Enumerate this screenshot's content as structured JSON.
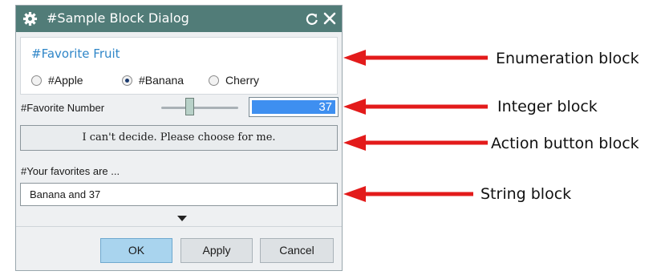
{
  "dialog": {
    "title": "#Sample Block Dialog",
    "title_bar_color": "#517c78",
    "enumeration": {
      "title": "#Favorite Fruit",
      "options": [
        "#Apple",
        "#Banana",
        "Cherry"
      ],
      "selected": "#Banana"
    },
    "integer": {
      "label": "#Favorite Number",
      "value": "37"
    },
    "action_button_label": "I can't decide. Please choose for me.",
    "string": {
      "label": "#Your favorites are ...",
      "value": "Banana and 37"
    },
    "buttons": {
      "ok": "OK",
      "apply": "Apply",
      "cancel": "Cancel"
    }
  },
  "annotations": [
    "Enumeration block",
    "Integer block",
    "Action button block",
    "String block"
  ],
  "arrow_color": "#e31b1b",
  "icons": [
    "gear-icon",
    "reset-icon",
    "close-icon",
    "expand-more-icon",
    "arrow-icon"
  ]
}
